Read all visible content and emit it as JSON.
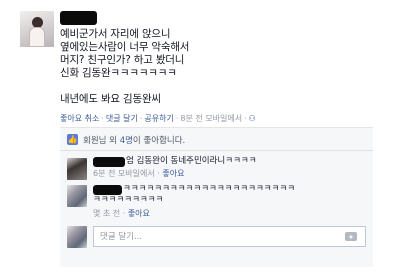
{
  "post": {
    "lines": [
      "예비군가서 자리에 앉으니",
      "옆에있는사람이 너무 악숙해서",
      "머지? 친구인가? 하고 봤더니",
      "신화 김동완ㅋㅋㅋㅋㅋㅋㅋ",
      "",
      "내년에도 봐요 김동완씨"
    ]
  },
  "actions": {
    "like": "좋아요 취소",
    "comment": "댓글 달기",
    "share": "공유하기",
    "time": "8분 전 모바일에서"
  },
  "likes": {
    "prefix": "회원님 외 ",
    "count": "4명",
    "suffix": "이 좋아합니다."
  },
  "comments": [
    {
      "text": "엄 김동완이 동네주민이라니ㅋㅋㅋㅋ",
      "time": "6분 전 모바일에서",
      "like": "좋아요"
    },
    {
      "text_line1": "ㅋㅋㅋㅋㅋㅋㅋㅋㅋㅋㅋㅋㅋㅋㅋㅋㅋㅋㅋㅋㅋㅋ",
      "text_line2": "ㅋㅋㅋㅋㅋㅋㅋㅋㅋ",
      "time": "몇 초 전",
      "like": "좋아요"
    }
  ],
  "reply": {
    "placeholder": "댓글 달기..."
  },
  "icons": {
    "like": "thumbs-up-icon",
    "camera": "camera-icon"
  },
  "colors": {
    "link": "#3b5998",
    "meta": "#9197a3",
    "ufi_bg": "#f6f7f9"
  }
}
